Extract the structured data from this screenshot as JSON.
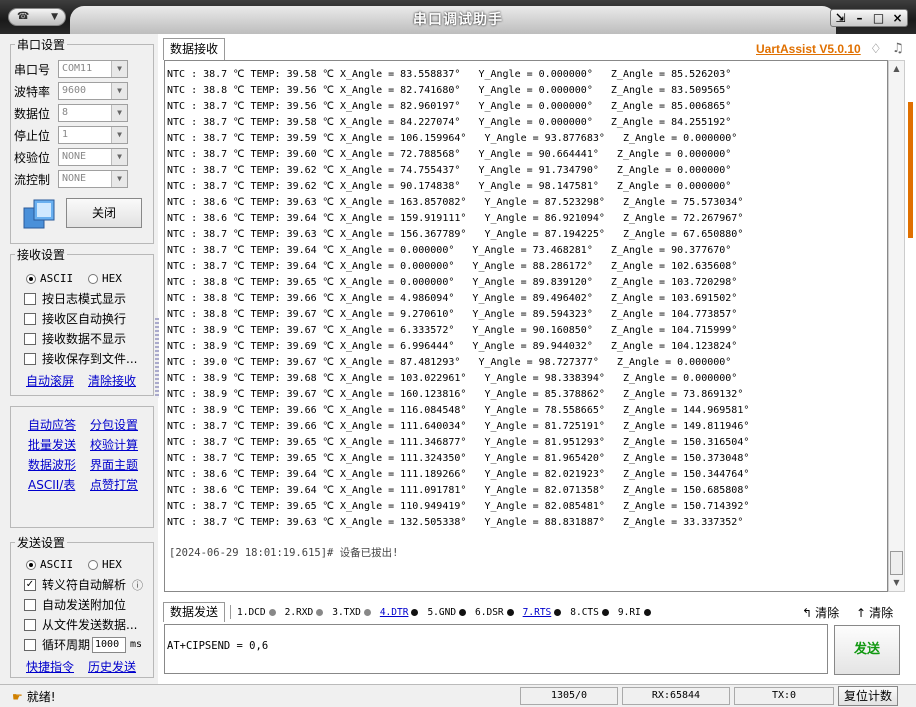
{
  "window": {
    "title": "串口调试助手",
    "sys_menu_label": "☎"
  },
  "brand": "UartAssist V5.0.10",
  "serial_settings": {
    "title": "串口设置",
    "fields": [
      {
        "label": "串口号",
        "value": "COM11"
      },
      {
        "label": "波特率",
        "value": "9600"
      },
      {
        "label": "数据位",
        "value": "8"
      },
      {
        "label": "停止位",
        "value": "1"
      },
      {
        "label": "校验位",
        "value": "NONE"
      },
      {
        "label": "流控制",
        "value": "NONE"
      }
    ],
    "close_button": "关闭"
  },
  "receive_settings": {
    "title": "接收设置",
    "mode_ascii": "ASCII",
    "mode_hex": "HEX",
    "options": [
      {
        "label": "按日志模式显示",
        "checked": false
      },
      {
        "label": "接收区自动换行",
        "checked": false
      },
      {
        "label": "接收数据不显示",
        "checked": false
      },
      {
        "label": "接收保存到文件...",
        "checked": false
      }
    ],
    "auto_scroll": "自动滚屏",
    "clear_receive": "清除接收"
  },
  "tools": {
    "links": [
      "自动应答",
      "分包设置",
      "批量发送",
      "校验计算",
      "数据波形",
      "界面主题",
      "ASCII/表",
      "点赞打赏"
    ]
  },
  "send_settings": {
    "title": "发送设置",
    "mode_ascii": "ASCII",
    "mode_hex": "HEX",
    "options": [
      {
        "label": "转义符自动解析",
        "checked": true
      },
      {
        "label": "自动发送附加位",
        "checked": false
      },
      {
        "label": "从文件发送数据...",
        "checked": false
      },
      {
        "label": "循环周期",
        "checked": false
      }
    ],
    "period_value": "1000",
    "period_unit": "ms",
    "shortcuts": "快捷指令",
    "history": "历史发送"
  },
  "receive": {
    "tab_label": "数据接收",
    "lines": [
      "NTC : 38.7 ℃ TEMP: 39.58 ℃ X_Angle = 83.558837°   Y_Angle = 0.000000°   Z_Angle = 85.526203°",
      "NTC : 38.8 ℃ TEMP: 39.56 ℃ X_Angle = 82.741680°   Y_Angle = 0.000000°   Z_Angle = 83.509565°",
      "NTC : 38.7 ℃ TEMP: 39.56 ℃ X_Angle = 82.960197°   Y_Angle = 0.000000°   Z_Angle = 85.006865°",
      "NTC : 38.7 ℃ TEMP: 39.58 ℃ X_Angle = 84.227074°   Y_Angle = 0.000000°   Z_Angle = 84.255192°",
      "NTC : 38.7 ℃ TEMP: 39.59 ℃ X_Angle = 106.159964°   Y_Angle = 93.877683°   Z_Angle = 0.000000°",
      "NTC : 38.7 ℃ TEMP: 39.60 ℃ X_Angle = 72.788568°   Y_Angle = 90.664441°   Z_Angle = 0.000000°",
      "NTC : 38.7 ℃ TEMP: 39.62 ℃ X_Angle = 74.755437°   Y_Angle = 91.734790°   Z_Angle = 0.000000°",
      "NTC : 38.7 ℃ TEMP: 39.62 ℃ X_Angle = 90.174838°   Y_Angle = 98.147581°   Z_Angle = 0.000000°",
      "NTC : 38.6 ℃ TEMP: 39.63 ℃ X_Angle = 163.857082°   Y_Angle = 87.523298°   Z_Angle = 75.573034°",
      "NTC : 38.6 ℃ TEMP: 39.64 ℃ X_Angle = 159.919111°   Y_Angle = 86.921094°   Z_Angle = 72.267967°",
      "NTC : 38.7 ℃ TEMP: 39.63 ℃ X_Angle = 156.367789°   Y_Angle = 87.194225°   Z_Angle = 67.650880°",
      "NTC : 38.7 ℃ TEMP: 39.64 ℃ X_Angle = 0.000000°   Y_Angle = 73.468281°   Z_Angle = 90.377670°",
      "NTC : 38.7 ℃ TEMP: 39.64 ℃ X_Angle = 0.000000°   Y_Angle = 88.286172°   Z_Angle = 102.635608°",
      "NTC : 38.8 ℃ TEMP: 39.65 ℃ X_Angle = 0.000000°   Y_Angle = 89.839120°   Z_Angle = 103.720298°",
      "NTC : 38.8 ℃ TEMP: 39.66 ℃ X_Angle = 4.986094°   Y_Angle = 89.496402°   Z_Angle = 103.691502°",
      "NTC : 38.8 ℃ TEMP: 39.67 ℃ X_Angle = 9.270610°   Y_Angle = 89.594323°   Z_Angle = 104.773857°",
      "NTC : 38.9 ℃ TEMP: 39.67 ℃ X_Angle = 6.333572°   Y_Angle = 90.160850°   Z_Angle = 104.715999°",
      "NTC : 38.9 ℃ TEMP: 39.69 ℃ X_Angle = 6.996444°   Y_Angle = 89.944032°   Z_Angle = 104.123824°",
      "NTC : 39.0 ℃ TEMP: 39.67 ℃ X_Angle = 87.481293°   Y_Angle = 98.727377°   Z_Angle = 0.000000°",
      "NTC : 38.9 ℃ TEMP: 39.68 ℃ X_Angle = 103.022961°   Y_Angle = 98.338394°   Z_Angle = 0.000000°",
      "NTC : 38.9 ℃ TEMP: 39.67 ℃ X_Angle = 160.123816°   Y_Angle = 85.378862°   Z_Angle = 73.869132°",
      "NTC : 38.9 ℃ TEMP: 39.66 ℃ X_Angle = 116.084548°   Y_Angle = 78.558665°   Z_Angle = 144.969581°",
      "NTC : 38.7 ℃ TEMP: 39.66 ℃ X_Angle = 111.640034°   Y_Angle = 81.725191°   Z_Angle = 149.811946°",
      "NTC : 38.7 ℃ TEMP: 39.65 ℃ X_Angle = 111.346877°   Y_Angle = 81.951293°   Z_Angle = 150.316504°",
      "NTC : 38.7 ℃ TEMP: 39.65 ℃ X_Angle = 111.324350°   Y_Angle = 81.965420°   Z_Angle = 150.373048°",
      "NTC : 38.6 ℃ TEMP: 39.64 ℃ X_Angle = 111.189266°   Y_Angle = 82.021923°   Z_Angle = 150.344764°",
      "NTC : 38.6 ℃ TEMP: 39.64 ℃ X_Angle = 111.091781°   Y_Angle = 82.071358°   Z_Angle = 150.685808°",
      "NTC : 38.7 ℃ TEMP: 39.65 ℃ X_Angle = 110.949419°   Y_Angle = 82.085481°   Z_Angle = 150.714392°",
      "NTC : 38.7 ℃ TEMP: 39.63 ℃ X_Angle = 132.505338°   Y_Angle = 88.831887°   Z_Angle = 33.337352°"
    ],
    "status_message": "[2024-06-29 18:01:19.615]# 设备已拔出!"
  },
  "send": {
    "tab_label": "数据发送",
    "pins": [
      {
        "label": "1.DCD",
        "link": false,
        "dot": "grey"
      },
      {
        "label": "2.RXD",
        "link": false,
        "dot": "grey"
      },
      {
        "label": "3.TXD",
        "link": false,
        "dot": "grey"
      },
      {
        "label": "4.DTR",
        "link": true,
        "dot": "black"
      },
      {
        "label": "5.GND",
        "link": false,
        "dot": "black"
      },
      {
        "label": "6.DSR",
        "link": false,
        "dot": "black"
      },
      {
        "label": "7.RTS",
        "link": true,
        "dot": "black"
      },
      {
        "label": "8.CTS",
        "link": false,
        "dot": "black"
      },
      {
        "label": "9.RI",
        "link": false,
        "dot": "black"
      }
    ],
    "clear_label": "清除",
    "clear_label_2": "清除",
    "input_value": "AT+CIPSEND = 0,6",
    "send_button": "发送"
  },
  "statusbar": {
    "ready": "就绪!",
    "counter": "1305/0",
    "rx": "RX:65844",
    "tx": "TX:0",
    "reset_button": "复位计数"
  }
}
